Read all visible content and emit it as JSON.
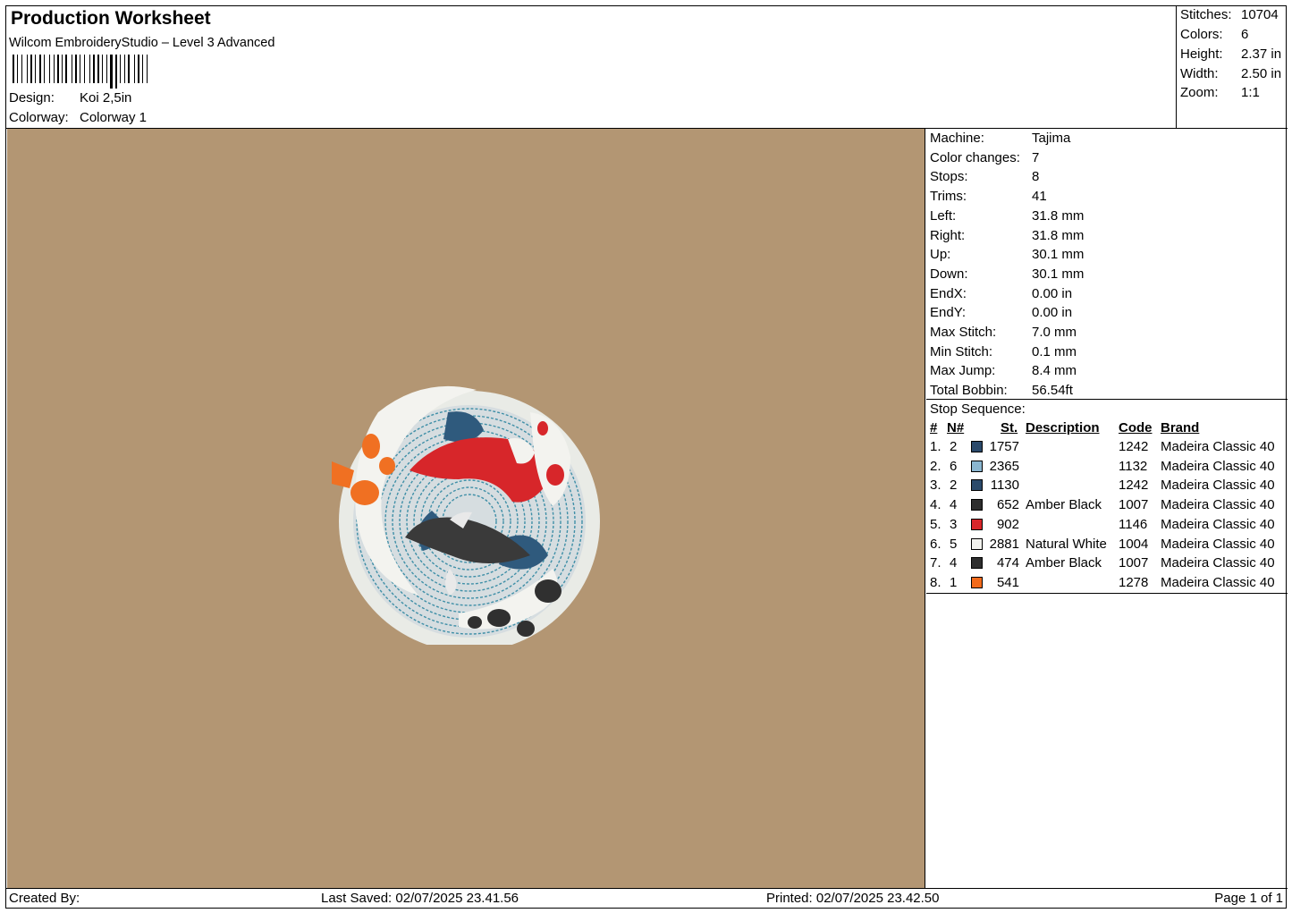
{
  "header": {
    "title": "Production Worksheet",
    "software": "Wilcom EmbroideryStudio – Level 3 Advanced",
    "design_label": "Design:",
    "design_value": "Koi 2,5in",
    "colorway_label": "Colorway:",
    "colorway_value": "Colorway 1"
  },
  "stats": [
    {
      "label": "Stitches:",
      "value": "10704"
    },
    {
      "label": "Colors:",
      "value": "6"
    },
    {
      "label": "Height:",
      "value": "2.37 in"
    },
    {
      "label": "Width:",
      "value": "2.50 in"
    },
    {
      "label": "Zoom:",
      "value": "1:1"
    }
  ],
  "canvas": {
    "background_color": "#b39673"
  },
  "machine_info": [
    {
      "label": "Machine:",
      "value": "Tajima"
    },
    {
      "label": "Color changes:",
      "value": "7"
    },
    {
      "label": "Stops:",
      "value": "8"
    },
    {
      "label": "Trims:",
      "value": "41"
    },
    {
      "label": "Left:",
      "value": "31.8 mm"
    },
    {
      "label": "Right:",
      "value": "31.8 mm"
    },
    {
      "label": "Up:",
      "value": "30.1 mm"
    },
    {
      "label": "Down:",
      "value": "30.1 mm"
    },
    {
      "label": "EndX:",
      "value": "0.00 in"
    },
    {
      "label": "EndY:",
      "value": "0.00 in"
    },
    {
      "label": "Max Stitch:",
      "value": "7.0 mm"
    },
    {
      "label": "Min Stitch:",
      "value": "0.1 mm"
    },
    {
      "label": "Max Jump:",
      "value": "8.4 mm"
    },
    {
      "label": "Total Bobbin:",
      "value": "56.54ft"
    }
  ],
  "stop_sequence": {
    "title": "Stop Sequence:",
    "headers": {
      "idx": "#",
      "needle": "N#",
      "st": "St.",
      "description": "Description",
      "code": "Code",
      "brand": "Brand"
    },
    "rows": [
      {
        "idx": "1.",
        "needle": "2",
        "color": "#2b4a6b",
        "st": "1757",
        "description": "",
        "code": "1242",
        "brand": "Madeira Classic 40"
      },
      {
        "idx": "2.",
        "needle": "6",
        "color": "#8ab6d0",
        "st": "2365",
        "description": "",
        "code": "1132",
        "brand": "Madeira Classic 40"
      },
      {
        "idx": "3.",
        "needle": "2",
        "color": "#2b4a6b",
        "st": "1130",
        "description": "",
        "code": "1242",
        "brand": "Madeira Classic 40"
      },
      {
        "idx": "4.",
        "needle": "4",
        "color": "#2e2e2e",
        "st": "652",
        "description": "Amber Black",
        "code": "1007",
        "brand": "Madeira Classic 40"
      },
      {
        "idx": "5.",
        "needle": "3",
        "color": "#d8262a",
        "st": "902",
        "description": "",
        "code": "1146",
        "brand": "Madeira Classic 40"
      },
      {
        "idx": "6.",
        "needle": "5",
        "color": "#f2f2ee",
        "st": "2881",
        "description": "Natural White",
        "code": "1004",
        "brand": "Madeira Classic 40"
      },
      {
        "idx": "7.",
        "needle": "4",
        "color": "#2e2e2e",
        "st": "474",
        "description": "Amber Black",
        "code": "1007",
        "brand": "Madeira Classic 40"
      },
      {
        "idx": "8.",
        "needle": "1",
        "color": "#f26a1b",
        "st": "541",
        "description": "",
        "code": "1278",
        "brand": "Madeira Classic 40"
      }
    ]
  },
  "footer": {
    "created_by": "Created By:",
    "last_saved": "Last Saved: 02/07/2025 23.41.56",
    "printed": "Printed: 02/07/2025 23.42.50",
    "page": "Page 1 of 1"
  }
}
